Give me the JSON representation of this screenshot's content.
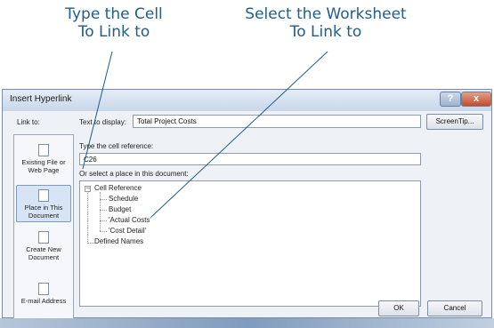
{
  "callouts": {
    "cell_line1": "Type the Cell",
    "cell_line2": "To Link to",
    "worksheet_line1": "Select the Worksheet",
    "worksheet_line2": "To Link to"
  },
  "dialog": {
    "title": "Insert Hyperlink",
    "help_glyph": "?",
    "close_glyph": "x",
    "link_to_label": "Link to:",
    "text_to_display_label": "Text to display:",
    "text_to_display_value": "Total Project Costs",
    "screentip_label": "ScreenTip...",
    "cell_reference_label": "Type the cell reference:",
    "cell_reference_value": "C26",
    "place_label": "Or select a place in this document:",
    "link_options": [
      {
        "label": "Existing File or Web Page",
        "icon": "globe-file-icon"
      },
      {
        "label": "Place in This Document",
        "icon": "document-place-icon"
      },
      {
        "label": "Create New Document",
        "icon": "new-document-icon"
      },
      {
        "label": "E-mail Address",
        "icon": "email-icon"
      }
    ],
    "tree": {
      "root": "Cell Reference",
      "expander": "−",
      "children": [
        "Schedule",
        "Budget",
        "'Actual Costs'",
        "'Cost Detail'"
      ],
      "defined_names": "Defined Names"
    },
    "ok_label": "OK",
    "cancel_label": "Cancel"
  }
}
